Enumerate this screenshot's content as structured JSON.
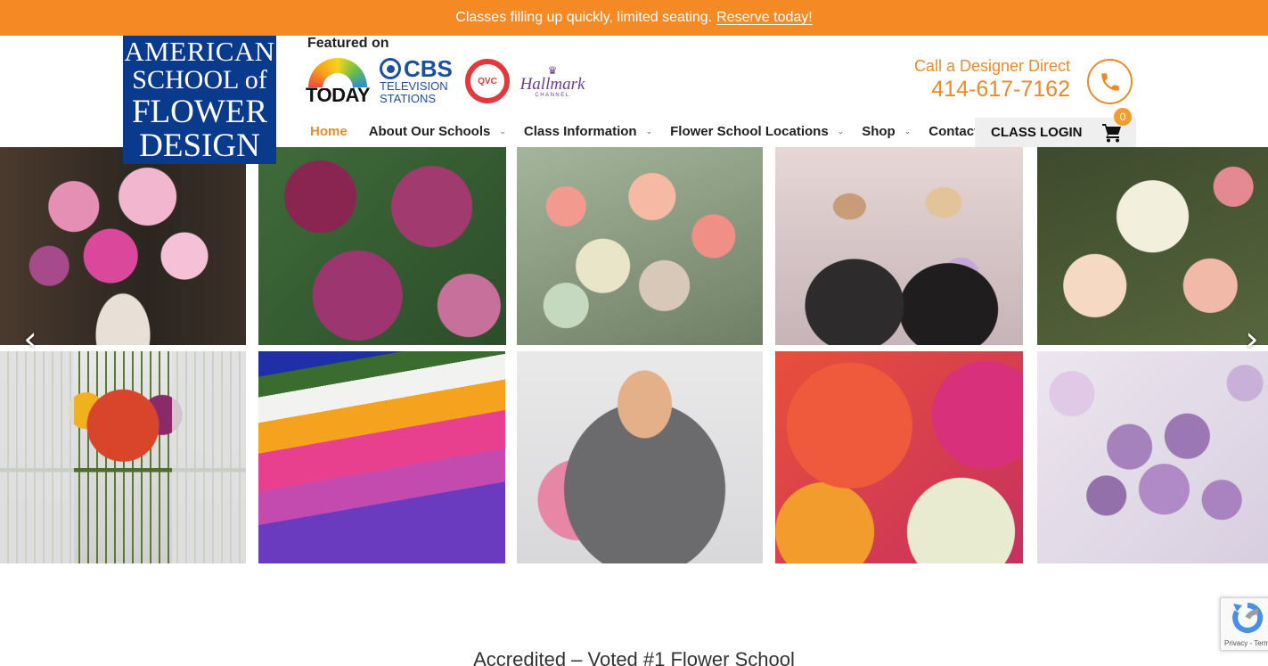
{
  "announcement": {
    "text": "Classes filling up quickly, limited seating.",
    "link": "Reserve today!",
    "background": "#f58a24"
  },
  "logo": {
    "line1": "AMERICAN",
    "line2": "SCHOOL of",
    "line3": "FLOWER",
    "line4": "DESIGN",
    "color": "#0a3a8c"
  },
  "featured": {
    "label": "Featured on",
    "outlets": [
      {
        "name": "TODAY",
        "icon": "today-show-logo"
      },
      {
        "name": "CBS",
        "sub1": "TELEVISION",
        "sub2": "STATIONS",
        "icon": "cbs-eye-logo"
      },
      {
        "name": "QVC",
        "icon": "qvc-logo"
      },
      {
        "name": "Hallmark",
        "sub": "CHANNEL",
        "icon": "hallmark-crown-logo"
      }
    ]
  },
  "contact": {
    "label": "Call a Designer Direct",
    "phone": "414-617-7162",
    "icon": "phone-icon",
    "accent": "#e98b2a"
  },
  "nav": {
    "items": [
      {
        "label": "Home",
        "active": true
      },
      {
        "label": "About Our Schools",
        "has_dropdown": true
      },
      {
        "label": "Class Information",
        "has_dropdown": true
      },
      {
        "label": "Flower School Locations",
        "has_dropdown": true
      },
      {
        "label": "Shop",
        "has_dropdown": true
      },
      {
        "label": "Contact"
      }
    ],
    "login": "CLASS LOGIN",
    "cart_icon": "shopping-cart-icon",
    "cart_count": "0"
  },
  "gallery": {
    "prev_icon": "chevron-left-icon",
    "next_icon": "chevron-right-icon",
    "prev_glyph": "‹",
    "next_glyph": "›",
    "images": [
      "pink-peony-arrangement-in-urn",
      "burgundy-peonies",
      "peach-rose-and-hydrangea-bouquet",
      "two-florists-holding-bouquets",
      "white-calla-lily-and-rose-bouquet",
      "mixed-hand-tied-bouquet",
      "striped-flower-fields",
      "man-holding-pink-rose-bouquet",
      "orange-and-magenta-roses",
      "lavender-rose-bouquet"
    ]
  },
  "section": {
    "heading": "Accredited – Voted #1 Flower School"
  },
  "recaptcha": {
    "text": "Privacy - Terms"
  }
}
